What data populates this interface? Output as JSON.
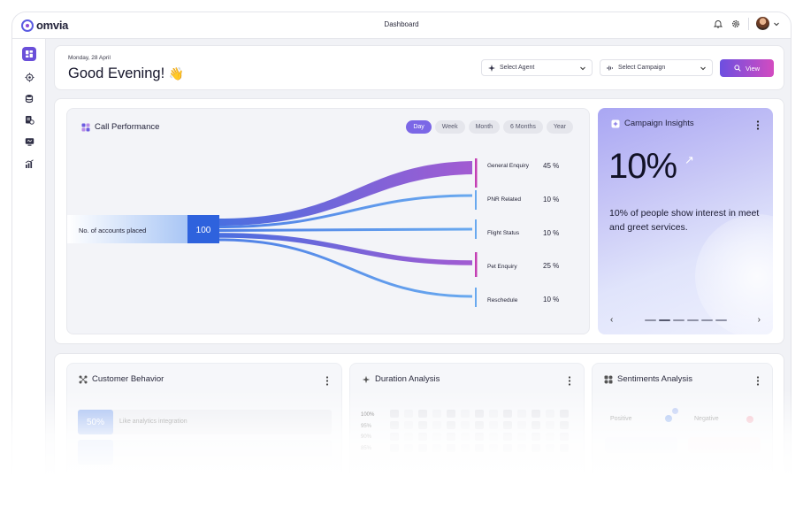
{
  "app": {
    "logo_text": "omvia",
    "page_title": "Dashboard"
  },
  "header": {
    "icons": [
      "bell-icon",
      "gear-icon",
      "avatar",
      "chevron-down-icon"
    ]
  },
  "sidebar": {
    "items": [
      "dashboard-icon",
      "target-icon",
      "database-icon",
      "list-settings-icon",
      "monitor-icon",
      "analytics-icon"
    ],
    "active_index": 0
  },
  "greeting": {
    "date": "Monday, 28 April",
    "text": "Good Evening!",
    "emoji": "👋"
  },
  "filters": {
    "agent_label": "Select Agent",
    "campaign_label": "Select Campaign",
    "view_label": "View"
  },
  "call_performance": {
    "title": "Call Performance",
    "tabs": [
      "Day",
      "Week",
      "Month",
      "6 Months",
      "Year"
    ],
    "active_tab": "Day",
    "source_label": "No. of accounts placed",
    "source_value": "100",
    "targets": [
      {
        "label": "General Enquiry",
        "value": "45 %",
        "color": "#9b59cf"
      },
      {
        "label": "PNR Related",
        "value": "10 %",
        "color": "#5b9ef0"
      },
      {
        "label": "Flight Status",
        "value": "10 %",
        "color": "#5b9ef0"
      },
      {
        "label": "Pet Enquiry",
        "value": "25 %",
        "color": "#9b59cf"
      },
      {
        "label": "Reschedule",
        "value": "10 %",
        "color": "#5b9ef0"
      }
    ]
  },
  "campaign_insights": {
    "title": "Campaign Insights",
    "big_value": "10%",
    "description": "10% of people show interest in meet and greet services.",
    "prev": "‹",
    "next": "›",
    "active_dot": 1
  },
  "bottom_cards": {
    "customer_behavior": {
      "title": "Customer Behavior",
      "row_value": "50%",
      "row_label": "Like analytics integration"
    },
    "duration_analysis": {
      "title": "Duration Analysis",
      "y_labels": [
        "100%",
        "95%",
        "90%",
        "85%"
      ]
    },
    "sentiments_analysis": {
      "title": "Sentiments Analysis",
      "positive": "Positive",
      "negative": "Negative"
    }
  }
}
